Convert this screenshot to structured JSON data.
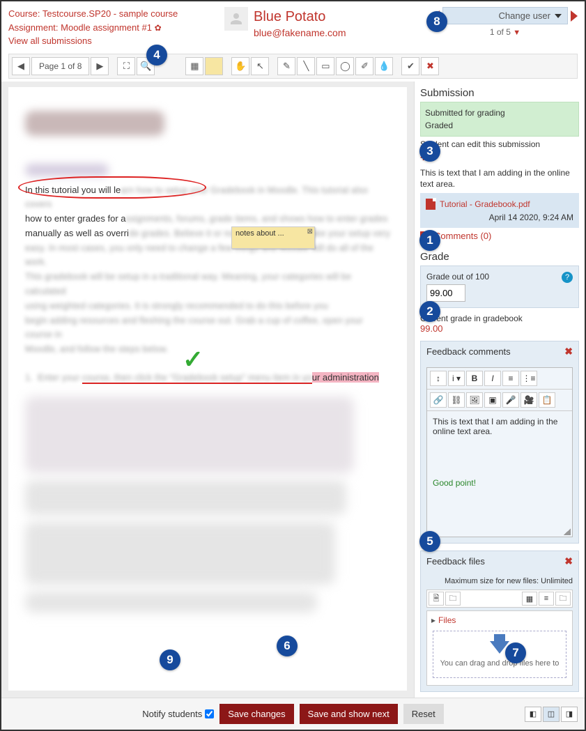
{
  "header": {
    "course_label": "Course: Testcourse.SP20 - sample course",
    "assignment_label": "Assignment: Moodle assignment #1",
    "view_all": "View all submissions",
    "user_name": "Blue Potato",
    "user_email": "blue@fakename.com",
    "change_user": "Change user",
    "user_pos": "1 of 5"
  },
  "toolbar": {
    "page_label": "Page 1 of 8"
  },
  "document": {
    "visible_text": "In this tutorial you will le",
    "line2a": "how to enter grades for a",
    "line3a": "manually as well as overri",
    "list_highlighted": "ur administration",
    "sticky_text": "notes about ..."
  },
  "submission": {
    "heading": "Submission",
    "status1": "Submitted for grading",
    "status2": "Graded",
    "edit_note": "Student can edit this submission",
    "online_text": "This is text that I am adding in the online text area.",
    "file_name": "Tutorial - Gradebook.pdf",
    "file_date": "April 14 2020, 9:24 AM",
    "comments_label": "Comments (0)"
  },
  "grade": {
    "heading": "Grade",
    "out_of_label": "Grade out of 100",
    "value": "99.00",
    "current_label": "Current grade in gradebook",
    "current_value": "99.00"
  },
  "feedback_comments": {
    "heading": "Feedback comments",
    "body_text": "This is text that I am adding in the online text area.",
    "extra_text": "Good point!"
  },
  "feedback_files": {
    "heading": "Feedback files",
    "maxsize": "Maximum size for new files: Unlimited",
    "files_label": "Files",
    "drop_text": "You can drag and drop files here to"
  },
  "footer": {
    "notify_label": "Notify students",
    "save_changes": "Save changes",
    "save_next": "Save and show next",
    "reset": "Reset"
  },
  "badges": {
    "b1": "1",
    "b2": "2",
    "b3": "3",
    "b4": "4",
    "b5": "5",
    "b6": "6",
    "b7": "7",
    "b8": "8",
    "b9": "9"
  }
}
